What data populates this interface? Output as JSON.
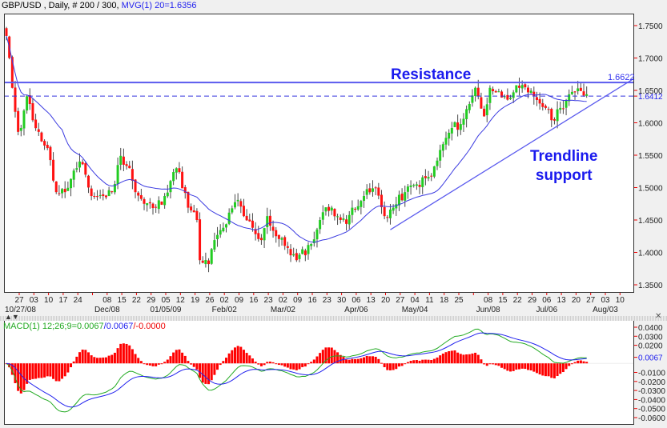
{
  "header": {
    "symbol_info": "GBP/USD , Daily, # 200 / 300,",
    "indicator": " MVG(1) 20=1.6356"
  },
  "macd_header": {
    "name": "MACD(1) 12;26;9=0.0067",
    "signal": "/0.0067",
    "hist": "/-0.0000"
  },
  "annotations": {
    "resistance": "Resistance",
    "trend_line1": "Trendline",
    "trend_line2": "support",
    "resistance_value": "1.6622"
  },
  "separator": {
    "icons": "▲▼",
    "close": "✕"
  },
  "colors": {
    "up": "#22cc22",
    "down": "#ff1111",
    "ma": "#3a3ae0",
    "line": "#5a5aee",
    "macd": "#22aa22",
    "signal": "#2222ee",
    "hist": "#ff0000"
  },
  "chart_data": {
    "type": "candlestick",
    "title": "GBP/USD , Daily",
    "ylim": [
      1.35,
      1.75
    ],
    "yticks": [
      "1.7500",
      "1.7000",
      "1.6500",
      "1.6000",
      "1.5500",
      "1.5000",
      "1.4500",
      "1.4000",
      "1.3500"
    ],
    "ytick_values": [
      1.75,
      1.7,
      1.65,
      1.6,
      1.55,
      1.5,
      1.45,
      1.4,
      1.35
    ],
    "highlight_label": "1.6412",
    "highlight_value": 1.6412,
    "resistance": 1.6622,
    "support_dashed": 1.6412,
    "trendline": [
      [
        131,
        1.435
      ],
      [
        214,
        1.668
      ]
    ],
    "ma_period": 20,
    "bars": 199,
    "close_keyframes": [
      [
        0,
        1.734
      ],
      [
        1,
        1.7
      ],
      [
        2,
        1.654
      ],
      [
        3,
        1.617
      ],
      [
        4,
        1.586
      ],
      [
        5,
        1.592
      ],
      [
        7,
        1.641
      ],
      [
        9,
        1.604
      ],
      [
        11,
        1.586
      ],
      [
        14,
        1.561
      ],
      [
        17,
        1.493
      ],
      [
        20,
        1.493
      ],
      [
        24,
        1.53
      ],
      [
        26,
        1.536
      ],
      [
        29,
        1.487
      ],
      [
        33,
        1.487
      ],
      [
        36,
        1.493
      ],
      [
        39,
        1.549
      ],
      [
        42,
        1.53
      ],
      [
        44,
        1.493
      ],
      [
        47,
        1.475
      ],
      [
        51,
        1.469
      ],
      [
        54,
        1.487
      ],
      [
        57,
        1.524
      ],
      [
        59,
        1.524
      ],
      [
        62,
        1.469
      ],
      [
        65,
        1.45
      ],
      [
        66,
        1.388
      ],
      [
        69,
        1.382
      ],
      [
        71,
        1.419
      ],
      [
        74,
        1.438
      ],
      [
        79,
        1.481
      ],
      [
        81,
        1.456
      ],
      [
        84,
        1.438
      ],
      [
        87,
        1.419
      ],
      [
        89,
        1.456
      ],
      [
        92,
        1.425
      ],
      [
        96,
        1.407
      ],
      [
        99,
        1.388
      ],
      [
        104,
        1.413
      ],
      [
        107,
        1.45
      ],
      [
        108,
        1.462
      ],
      [
        111,
        1.469
      ],
      [
        114,
        1.45
      ],
      [
        116,
        1.444
      ],
      [
        118,
        1.469
      ],
      [
        122,
        1.487
      ],
      [
        126,
        1.499
      ],
      [
        129,
        1.456
      ],
      [
        132,
        1.469
      ],
      [
        136,
        1.493
      ],
      [
        140,
        1.505
      ],
      [
        145,
        1.518
      ],
      [
        149,
        1.567
      ],
      [
        152,
        1.592
      ],
      [
        155,
        1.598
      ],
      [
        158,
        1.629
      ],
      [
        160,
        1.654
      ],
      [
        161,
        1.641
      ],
      [
        163,
        1.61
      ],
      [
        165,
        1.654
      ],
      [
        167,
        1.647
      ],
      [
        170,
        1.641
      ],
      [
        173,
        1.647
      ],
      [
        175,
        1.654
      ],
      [
        178,
        1.647
      ],
      [
        180,
        1.641
      ],
      [
        184,
        1.623
      ],
      [
        186,
        1.604
      ],
      [
        189,
        1.623
      ],
      [
        192,
        1.644
      ],
      [
        194,
        1.647
      ],
      [
        198,
        1.644
      ]
    ],
    "xticks": [
      [
        0,
        "27"
      ],
      [
        1,
        "03"
      ],
      [
        2,
        "10"
      ],
      [
        3,
        "17"
      ],
      [
        4,
        "24"
      ],
      [
        6,
        "08"
      ],
      [
        7,
        "15"
      ],
      [
        8,
        "22"
      ],
      [
        9,
        "29"
      ],
      [
        10,
        "05"
      ],
      [
        11,
        "12"
      ],
      [
        12,
        "19"
      ],
      [
        13,
        "26"
      ],
      [
        14,
        "02"
      ],
      [
        15,
        "09"
      ],
      [
        16,
        "16"
      ],
      [
        17,
        "23"
      ],
      [
        18,
        "02"
      ],
      [
        19,
        "09"
      ],
      [
        20,
        "16"
      ],
      [
        21,
        "23"
      ],
      [
        22,
        "30"
      ],
      [
        23,
        "06"
      ],
      [
        24,
        "13"
      ],
      [
        25,
        "20"
      ],
      [
        26,
        "27"
      ],
      [
        27,
        "04"
      ],
      [
        28,
        "11"
      ],
      [
        29,
        "18"
      ],
      [
        30,
        "25"
      ],
      [
        32,
        "08"
      ],
      [
        33,
        "15"
      ],
      [
        34,
        "22"
      ],
      [
        35,
        "29"
      ],
      [
        36,
        "06"
      ],
      [
        37,
        "13"
      ],
      [
        38,
        "20"
      ],
      [
        39,
        "27"
      ],
      [
        40,
        "03"
      ],
      [
        41,
        "10"
      ]
    ],
    "xmonths": [
      [
        0,
        "10/27/08"
      ],
      [
        6,
        "Dec/08"
      ],
      [
        10,
        "01/05/09"
      ],
      [
        14,
        "Feb/02"
      ],
      [
        18,
        "Mar/02"
      ],
      [
        23,
        "Apr/06"
      ],
      [
        27,
        "May/04"
      ],
      [
        32,
        "Jun/08"
      ],
      [
        36,
        "Jul/06"
      ],
      [
        40,
        "Aug/03"
      ]
    ],
    "macd": {
      "params": [
        12,
        26,
        9
      ],
      "ylim": [
        -0.06,
        0.04
      ],
      "yticks": [
        "0.0400",
        "0.0300",
        "0.0200",
        "-0.0100",
        "-0.0200",
        "-0.0300",
        "-0.0400",
        "-0.0500",
        "-0.0600"
      ],
      "ytick_values": [
        0.04,
        0.03,
        0.02,
        -0.01,
        -0.02,
        -0.03,
        -0.04,
        -0.05,
        -0.06
      ],
      "highlight_label": "0.0067",
      "highlight_value": 0.0067,
      "last_macd": 0.0067,
      "last_signal": 0.0067,
      "last_hist": -0.0
    }
  }
}
